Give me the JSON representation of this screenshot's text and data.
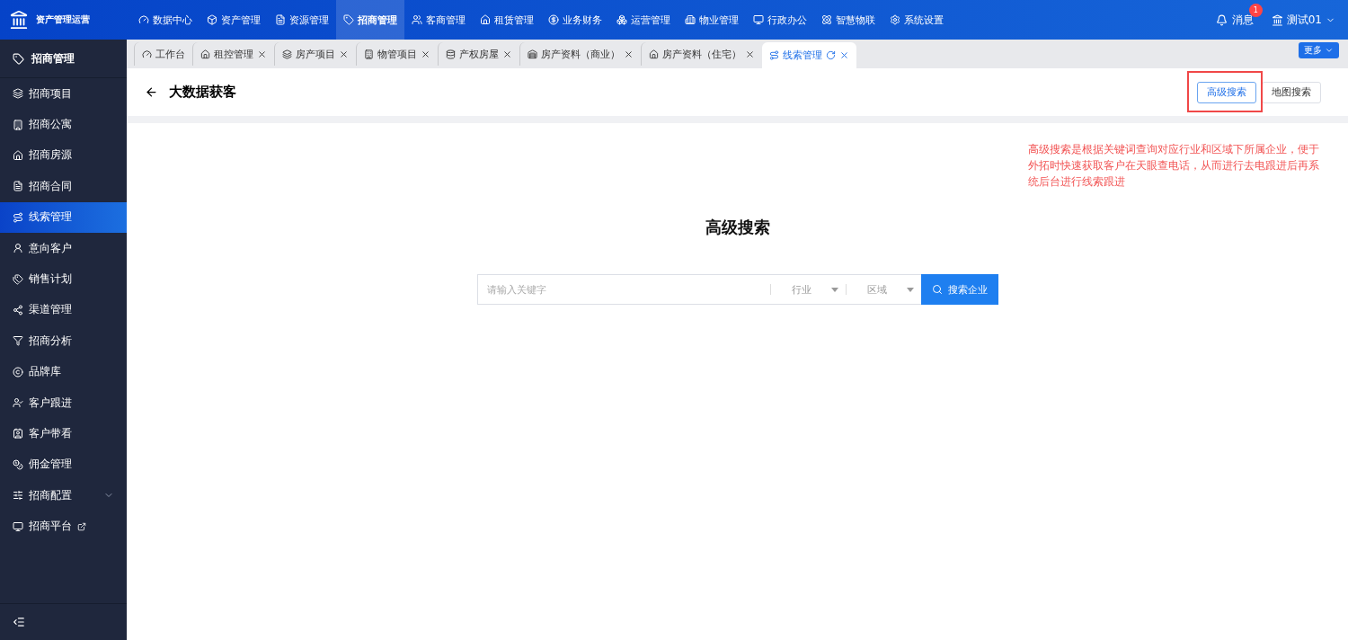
{
  "app": {
    "title": "资产管理运营"
  },
  "top_nav": [
    {
      "label": "数据中心",
      "selected": false
    },
    {
      "label": "资产管理",
      "selected": false
    },
    {
      "label": "资源管理",
      "selected": false
    },
    {
      "label": "招商管理",
      "selected": true
    },
    {
      "label": "客商管理",
      "selected": false
    },
    {
      "label": "租赁管理",
      "selected": false
    },
    {
      "label": "业务财务",
      "selected": false
    },
    {
      "label": "运营管理",
      "selected": false
    },
    {
      "label": "物业管理",
      "selected": false
    },
    {
      "label": "行政办公",
      "selected": false
    },
    {
      "label": "智慧物联",
      "selected": false
    },
    {
      "label": "系统设置",
      "selected": false
    }
  ],
  "messages": {
    "label": "消息",
    "badge": "1"
  },
  "user": {
    "name": "测试01"
  },
  "sidebar": {
    "title": "招商管理",
    "items": [
      {
        "label": "招商项目",
        "kind": "link",
        "selected": false
      },
      {
        "label": "招商公寓",
        "kind": "link",
        "selected": false
      },
      {
        "label": "招商房源",
        "kind": "link",
        "selected": false
      },
      {
        "label": "招商合同",
        "kind": "link",
        "selected": false
      },
      {
        "label": "线索管理",
        "kind": "link",
        "selected": true
      },
      {
        "label": "意向客户",
        "kind": "link",
        "selected": false
      },
      {
        "label": "销售计划",
        "kind": "link",
        "selected": false
      },
      {
        "label": "渠道管理",
        "kind": "link",
        "selected": false
      },
      {
        "label": "招商分析",
        "kind": "link",
        "selected": false
      },
      {
        "label": "品牌库",
        "kind": "link",
        "selected": false
      },
      {
        "label": "客户跟进",
        "kind": "link",
        "selected": false
      },
      {
        "label": "客户带看",
        "kind": "link",
        "selected": false
      },
      {
        "label": "佣金管理",
        "kind": "link",
        "selected": false
      },
      {
        "label": "招商配置",
        "kind": "group",
        "selected": false
      },
      {
        "label": "招商平台",
        "kind": "external",
        "selected": false
      }
    ]
  },
  "tabs": [
    {
      "label": "工作台",
      "closable": false,
      "selected": false
    },
    {
      "label": "租控管理",
      "closable": true,
      "selected": false
    },
    {
      "label": "房产项目",
      "closable": true,
      "selected": false
    },
    {
      "label": "物管项目",
      "closable": true,
      "selected": false
    },
    {
      "label": "产权房屋",
      "closable": true,
      "selected": false
    },
    {
      "label": "房产资料（商业）",
      "closable": true,
      "selected": false
    },
    {
      "label": "房产资料（住宅）",
      "closable": true,
      "selected": false
    },
    {
      "label": "线索管理",
      "closable": true,
      "selected": true
    }
  ],
  "more_button": "更多",
  "page": {
    "title": "大数据获客",
    "mode_buttons": [
      {
        "label": "高级搜索",
        "selected": true
      },
      {
        "label": "地图搜索",
        "selected": false
      }
    ],
    "note": "高级搜索是根据关键词查询对应行业和区域下所属企业，便于外拓时快速获取客户在天眼查电话，从而进行去电跟进后再系统后台进行线索跟进",
    "heading": "高级搜索",
    "search": {
      "placeholder": "请输入关键字",
      "industry": "行业",
      "region": "区域",
      "button": "搜索企业"
    }
  }
}
